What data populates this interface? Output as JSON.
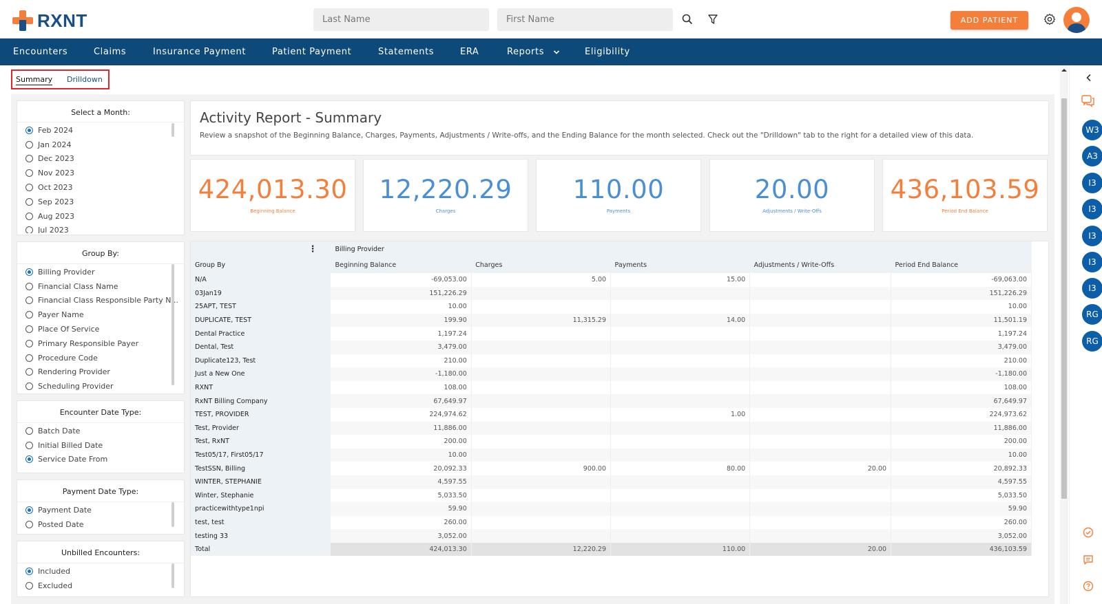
{
  "brand": {
    "name": "RXNT"
  },
  "search": {
    "last_name_placeholder": "Last Name",
    "first_name_placeholder": "First Name"
  },
  "header": {
    "add_patient_label": "ADD PATIENT"
  },
  "nav": {
    "items": [
      "Encounters",
      "Claims",
      "Insurance Payment",
      "Patient Payment",
      "Statements",
      "ERA",
      "Reports",
      "Eligibility"
    ]
  },
  "tabs": {
    "summary": "Summary",
    "drilldown": "Drilldown"
  },
  "filters": {
    "month": {
      "title": "Select a Month:",
      "options": [
        "Feb 2024",
        "Jan 2024",
        "Dec 2023",
        "Nov 2023",
        "Oct 2023",
        "Sep 2023",
        "Aug 2023",
        "Jul 2023"
      ],
      "selected": 0
    },
    "group_by": {
      "title": "Group By:",
      "options": [
        "Billing Provider",
        "Financial Class Name",
        "Financial Class Responsible Party N...",
        "Payer Name",
        "Place Of Service",
        "Primary Responsible Payer",
        "Procedure Code",
        "Rendering Provider",
        "Scheduling Provider"
      ],
      "selected": 0
    },
    "encounter_date_type": {
      "title": "Encounter Date Type:",
      "options": [
        "Batch Date",
        "Initial Billed Date",
        "Service Date From"
      ],
      "selected": 2
    },
    "payment_date_type": {
      "title": "Payment Date Type:",
      "options": [
        "Payment Date",
        "Posted Date"
      ],
      "selected": 0
    },
    "unbilled": {
      "title": "Unbilled Encounters:",
      "options": [
        "Included",
        "Excluded"
      ],
      "selected": 0
    }
  },
  "report": {
    "title": "Activity Report - Summary",
    "description": "Review a snapshot of the Beginning Balance, Charges, Payments, Adjustments / Write-offs, and the Ending Balance for the month selected. Check out the \"Drilldown\" tab to the right for a detailed view of this data."
  },
  "kpis": [
    {
      "value": "424,013.30",
      "label": "Beginning Balance",
      "color": "#f47f3b"
    },
    {
      "value": "12,220.29",
      "label": "Charges",
      "color": "#4a8fd4"
    },
    {
      "value": "110.00",
      "label": "Payments",
      "color": "#4a8fd4"
    },
    {
      "value": "20.00",
      "label": "Adjustments / Write-Offs",
      "color": "#4a8fd4"
    },
    {
      "value": "436,103.59",
      "label": "Period End Balance",
      "color": "#f47f3b"
    }
  ],
  "table": {
    "group_header": "Billing Provider",
    "columns": [
      "Group By",
      "Beginning Balance",
      "Charges",
      "Payments",
      "Adjustments / Write-Offs",
      "Period End Balance"
    ],
    "rows": [
      [
        "N/A",
        "-69,053.00",
        "5.00",
        "15.00",
        "",
        "-69,063.00"
      ],
      [
        "03Jan19",
        "151,226.29",
        "",
        "",
        "",
        "151,226.29"
      ],
      [
        "25APT, TEST",
        "10.00",
        "",
        "",
        "",
        "10.00"
      ],
      [
        "DUPLICATE, TEST",
        "199.90",
        "11,315.29",
        "14.00",
        "",
        "11,501.19"
      ],
      [
        "Dental Practice",
        "1,197.24",
        "",
        "",
        "",
        "1,197.24"
      ],
      [
        "Dental, Test",
        "3,479.00",
        "",
        "",
        "",
        "3,479.00"
      ],
      [
        "Duplicate123, Test",
        "210.00",
        "",
        "",
        "",
        "210.00"
      ],
      [
        "Just a New One",
        "-1,180.00",
        "",
        "",
        "",
        "-1,180.00"
      ],
      [
        "RXNT",
        "108.00",
        "",
        "",
        "",
        "108.00"
      ],
      [
        "RxNT Billing Company",
        "67,649.97",
        "",
        "",
        "",
        "67,649.97"
      ],
      [
        "TEST, PROVIDER",
        "224,974.62",
        "",
        "1.00",
        "",
        "224,973.62"
      ],
      [
        "Test, Provider",
        "11,886.00",
        "",
        "",
        "",
        "11,886.00"
      ],
      [
        "Test, RxNT",
        "200.00",
        "",
        "",
        "",
        "200.00"
      ],
      [
        "Test05/17, First05/17",
        "10.00",
        "",
        "",
        "",
        "10.00"
      ],
      [
        "TestSSN, Billing",
        "20,092.33",
        "900.00",
        "80.00",
        "20.00",
        "20,892.33"
      ],
      [
        "WINTER, STEPHANIE",
        "4,597.55",
        "",
        "",
        "",
        "4,597.55"
      ],
      [
        "Winter, Stephanie",
        "5,033.50",
        "",
        "",
        "",
        "5,033.50"
      ],
      [
        "practicewithtype1npi",
        "59.90",
        "",
        "",
        "",
        "59.90"
      ],
      [
        "test, test",
        "260.00",
        "",
        "",
        "",
        "260.00"
      ],
      [
        "testing 33",
        "3,052.00",
        "",
        "",
        "",
        "3,052.00"
      ]
    ],
    "total": [
      "Total",
      "424,013.30",
      "12,220.29",
      "110.00",
      "20.00",
      "436,103.59"
    ]
  },
  "right_sidebar": {
    "bubbles": [
      "W3",
      "A3",
      "I3",
      "I3",
      "I3",
      "I3",
      "I3",
      "RG",
      "RG"
    ]
  }
}
